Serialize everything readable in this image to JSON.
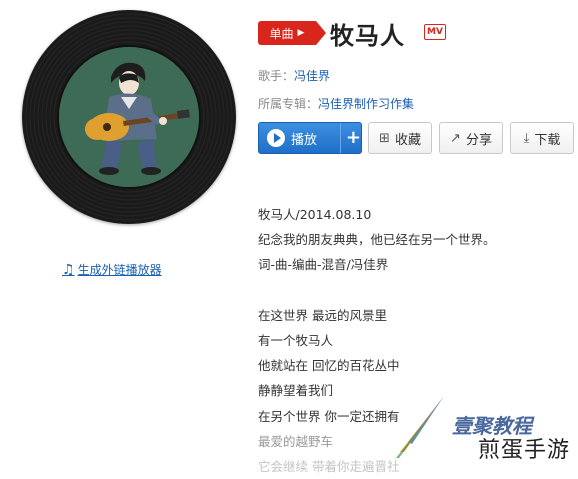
{
  "header": {
    "badge_label": "单曲",
    "song_title": "牧马人",
    "mv_badge": "MV"
  },
  "meta": {
    "artist_label": "歌手：",
    "artist_name": "冯佳界",
    "album_label": "所属专辑：",
    "album_name": "冯佳界制作习作集"
  },
  "actions": {
    "play_label": "播放",
    "add_label": "+",
    "favorite_label": "收藏",
    "share_label": "分享",
    "download_label": "下载"
  },
  "player_link": {
    "label": "生成外链播放器",
    "icon": "music-note-icon"
  },
  "lyrics": [
    "牧马人/2014.08.10",
    "纪念我的朋友典典，他已经在另一个世界。",
    "词-曲-编曲-混音/冯佳界",
    "",
    "在这世界 最远的风景里",
    "有一个牧马人",
    "他就站在 回忆的百花丛中",
    "静静望着我们",
    "在另个世界 你一定还拥有",
    "最爱的越野车",
    "它会继续 带着你走遍晋社"
  ],
  "watermark": {
    "small": "壹聚教程",
    "main": "煎蛋手游"
  },
  "colors": {
    "badge_red": "#d9261c",
    "link_blue": "#1a5fb4",
    "play_blue": "#1f6fc8"
  }
}
